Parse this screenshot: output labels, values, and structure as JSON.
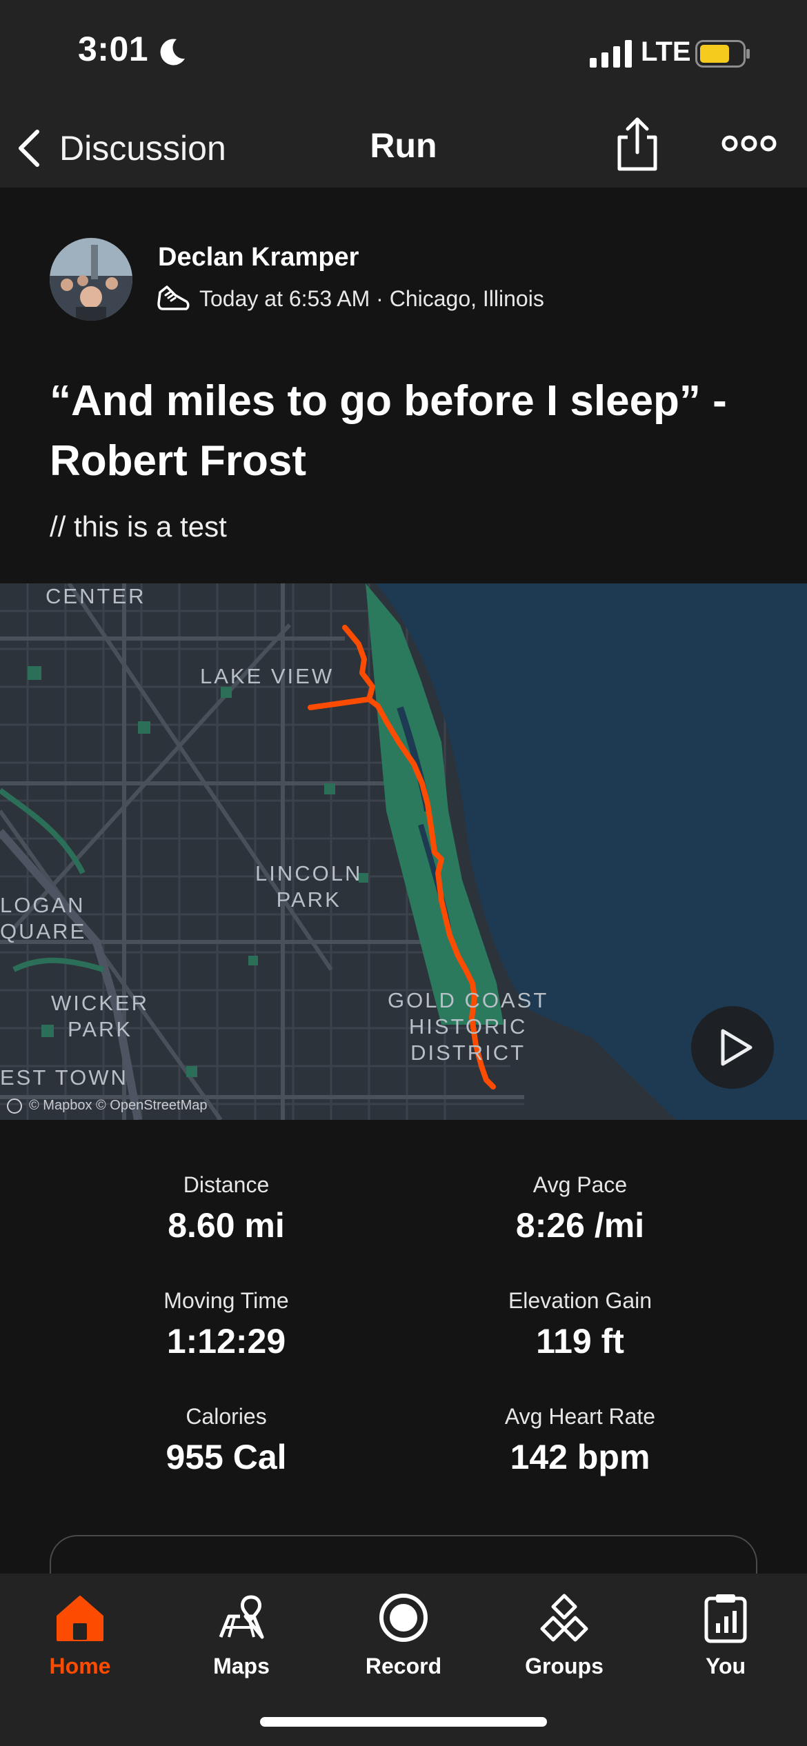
{
  "status_bar": {
    "time": "3:01",
    "network": "LTE",
    "icons": [
      "moon-icon",
      "signal-icon",
      "battery-icon"
    ]
  },
  "nav": {
    "back_label": "Discussion",
    "title": "Run",
    "icons": [
      "chevron-left-icon",
      "share-icon",
      "more-icon"
    ]
  },
  "activity": {
    "athlete_name": "Declan Kramper",
    "meta": "Today at 6:53 AM · Chicago, Illinois",
    "title_line1": "“And miles to go before I sleep” -",
    "title_line2": "Robert Frost",
    "description": "// this is a test"
  },
  "map": {
    "labels": {
      "center": "CENTER",
      "lake_view": "LAKE VIEW",
      "lincoln_park": "LINCOLN\nPARK",
      "logan_square": "LOGAN\nQUARE",
      "wicker_park": "WICKER\nPARK",
      "east_town": "EST TOWN",
      "gold_coast": "GOLD COAST\nHISTORIC\nDISTRICT"
    },
    "attribution": "© Mapbox © OpenStreetMap",
    "route_color": "#fc4c02",
    "water_color": "#1d3a52"
  },
  "stats": {
    "distance": {
      "label": "Distance",
      "value": "8.60 mi"
    },
    "avg_pace": {
      "label": "Avg Pace",
      "value": "8:26 /mi"
    },
    "moving_time": {
      "label": "Moving Time",
      "value": "1:12:29"
    },
    "elevation_gain": {
      "label": "Elevation Gain",
      "value": "119 ft"
    },
    "calories": {
      "label": "Calories",
      "value": "955 Cal"
    },
    "avg_heart_rate": {
      "label": "Avg Heart Rate",
      "value": "142 bpm"
    }
  },
  "tabs": [
    {
      "label": "Home",
      "icon": "home-icon",
      "active": true
    },
    {
      "label": "Maps",
      "icon": "maps-icon",
      "active": false
    },
    {
      "label": "Record",
      "icon": "record-icon",
      "active": false
    },
    {
      "label": "Groups",
      "icon": "groups-icon",
      "active": false
    },
    {
      "label": "You",
      "icon": "clipboard-icon",
      "active": false
    }
  ],
  "colors": {
    "accent": "#fc4c02",
    "background": "#141414",
    "bar": "#232323"
  }
}
